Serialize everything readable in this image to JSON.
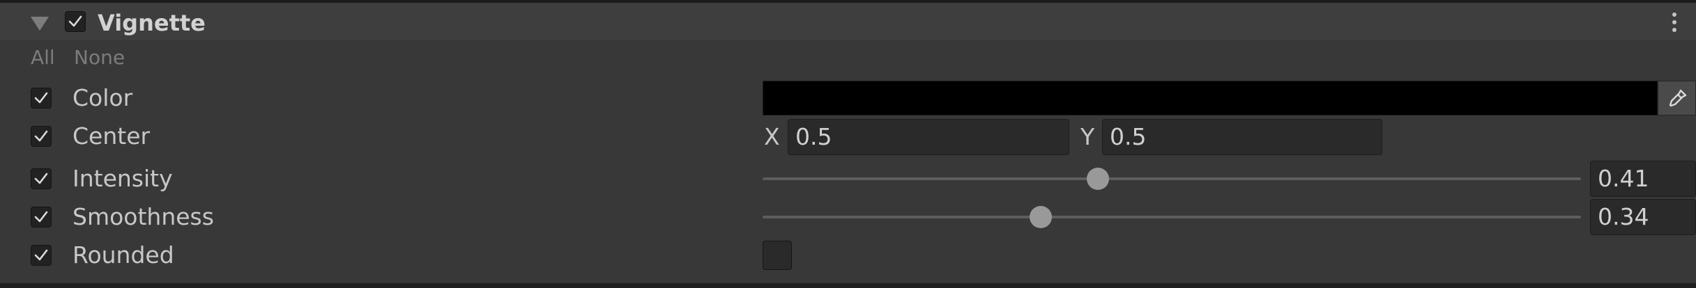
{
  "header": {
    "title": "Vignette",
    "enabled": true,
    "menu_icon": "kebab-menu-icon",
    "foldout_icon": "foldout-arrow-icon"
  },
  "override_toggles": {
    "all_label": "All",
    "none_label": "None"
  },
  "properties": {
    "color": {
      "label": "Color",
      "override": true,
      "value_hex": "#000000",
      "picker_icon": "eyedropper-icon"
    },
    "center": {
      "label": "Center",
      "override": true,
      "x_label": "X",
      "x_value": "0.5",
      "y_label": "Y",
      "y_value": "0.5"
    },
    "intensity": {
      "label": "Intensity",
      "override": true,
      "value": "0.41",
      "slider_fraction": 0.41
    },
    "smoothness": {
      "label": "Smoothness",
      "override": true,
      "value": "0.34",
      "slider_fraction": 0.34
    },
    "rounded": {
      "label": "Rounded",
      "override": true,
      "checked": false
    }
  },
  "colors": {
    "panel_background": "#383838",
    "header_background": "#3e3e3e",
    "field_background": "#2a2a2a",
    "slider_thumb": "#999999"
  }
}
